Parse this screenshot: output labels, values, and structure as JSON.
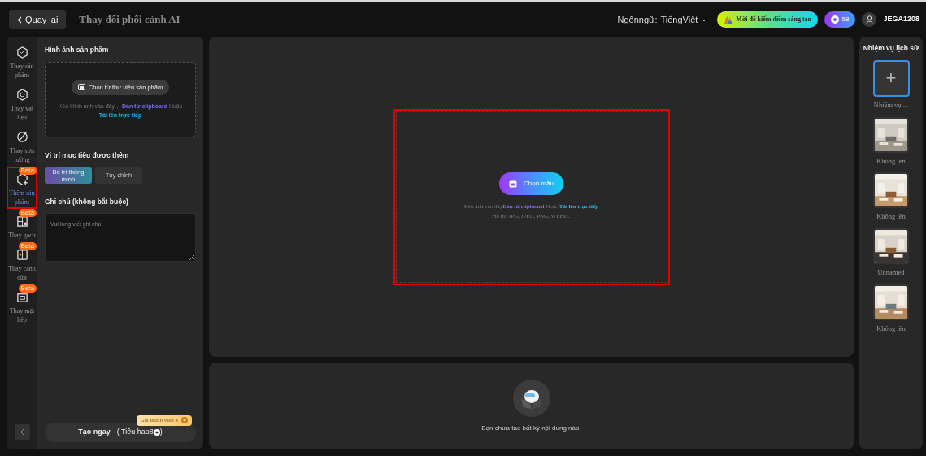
{
  "header": {
    "back_button": "Quay lại",
    "title": "Thay đổi phối cảnh AI",
    "language_label": "Ngônngữ:",
    "language_value": "TiếngViệt",
    "invite_button": "Mời để kiếm điểm sáng tạo",
    "points": "58",
    "username": "JEGA1208"
  },
  "sidebar": {
    "items": [
      {
        "label": "Thay sản phẩm",
        "selected": false
      },
      {
        "label": "Thay vật liệu",
        "selected": false
      },
      {
        "label": "Thay sơn tường",
        "selected": false
      },
      {
        "label": "Thêm sản phẩm",
        "selected": true,
        "badge": "Beta"
      },
      {
        "label": "Thay gạch",
        "selected": false,
        "badge": "Beta"
      },
      {
        "label": "Thay cánh cửa",
        "selected": false,
        "badge": "Beta"
      },
      {
        "label": "Thay mặt bếp",
        "selected": false,
        "badge": "Beta"
      }
    ]
  },
  "product_panel": {
    "title": "Hình ảnh sản phẩm",
    "library_button": "Chọn từ thư viện sản phẩm",
    "drop_text": "Kéo Hình ảnh vào đây，",
    "paste_link": "Dán từ clipboard",
    "or_text": "Hoặc",
    "upload_link": "Tải lên trực tiếp",
    "position_title": "Vị trí mục tiêu được thêm",
    "position_options": [
      {
        "label": "Bố trí thông minh",
        "selected": true
      },
      {
        "label": "Tùy chỉnh",
        "selected": false
      }
    ],
    "note_title": "Ghi chú (không bắt buộc)",
    "note_placeholder": "Vui lòng viết ghi chú",
    "member_price": "Giá thành viên 4",
    "generate_button": "Tạo ngay",
    "cost_text": "( Tiêu hao8",
    "cost_close": ")"
  },
  "canvas": {
    "template_button": "Chọn mẫu",
    "drop_text": "Kéo ảnh vào đây",
    "paste_link": "Dán từ clipboard",
    "or_text": " Hoặc ",
    "upload_link": "Tải lên trực tiếp",
    "formats": "Hỗ trợ JPG, JPEG, PNG, WEBP..."
  },
  "results": {
    "empty_text": "Bạn chưa tạo bất kỳ nội dung nào!"
  },
  "history": {
    "title": "Nhiệm vụ lịch sử",
    "tasks": [
      {
        "kind": "new",
        "icon": "+",
        "label": "Nhiệm vụ ...",
        "selected": true
      },
      {
        "kind": "picture",
        "label": "Không tên",
        "selected": false
      },
      {
        "kind": "picture",
        "label": "Không tên",
        "selected": false
      },
      {
        "kind": "picture",
        "label": "Unnamed",
        "selected": false
      },
      {
        "kind": "picture",
        "label": "Không tên",
        "selected": false
      }
    ]
  }
}
